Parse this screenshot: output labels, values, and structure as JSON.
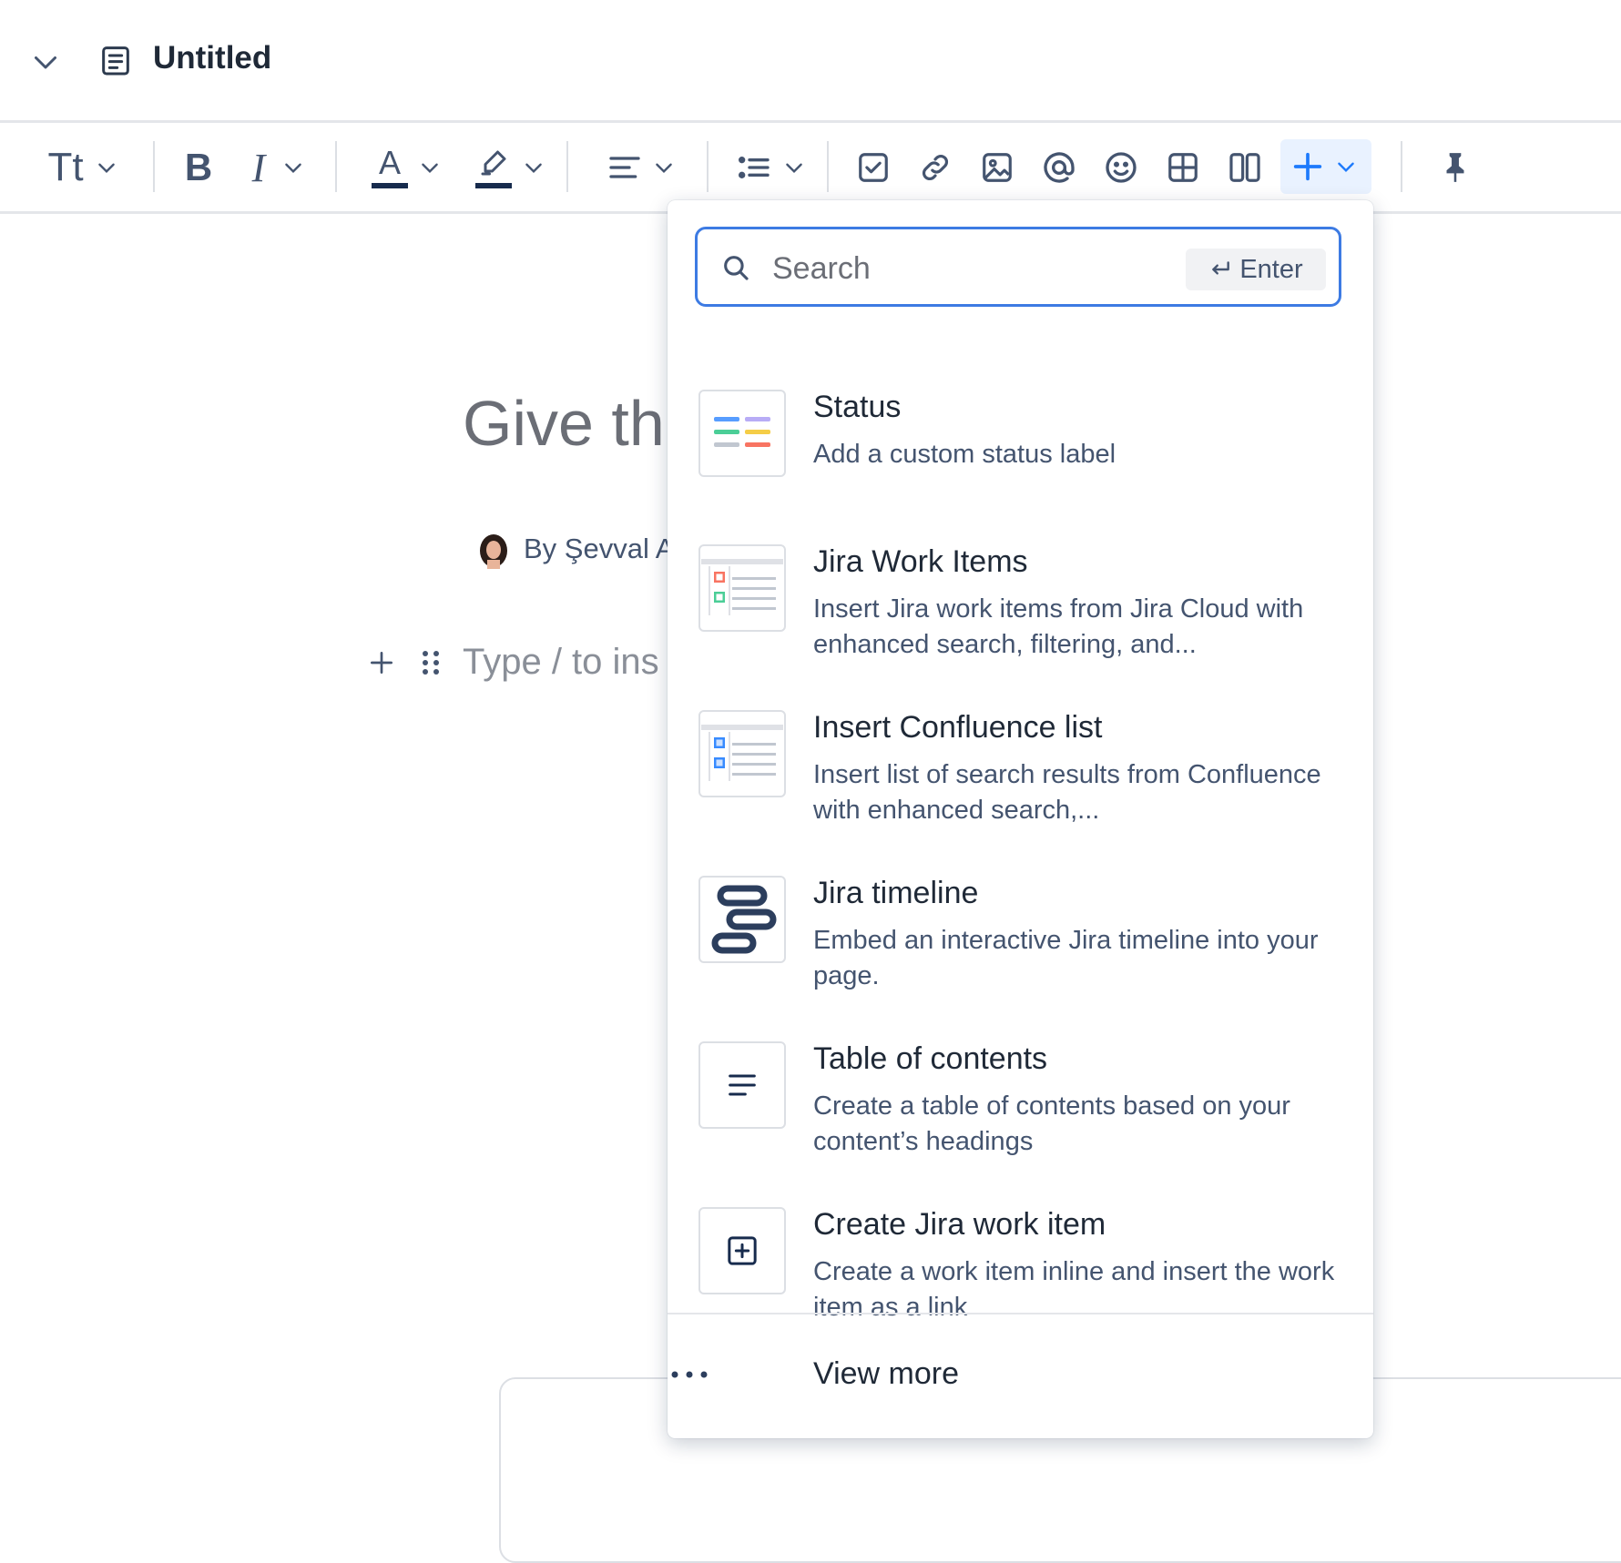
{
  "header": {
    "title": "Untitled",
    "collapse_icon": "chevron-down-icon",
    "page_icon": "document-icon"
  },
  "toolbar": {
    "text_style_label": "Tt",
    "icons": [
      "bold-icon",
      "italic-icon",
      "text-color-icon",
      "highlight-icon",
      "align-icon",
      "list-icon",
      "action-item-icon",
      "link-icon",
      "image-icon",
      "mention-icon",
      "emoji-icon",
      "table-icon",
      "layout-icon",
      "insert-icon",
      "pin-icon"
    ],
    "text_color": "#172b4d",
    "accent": "#1d7afc"
  },
  "editor": {
    "title_placeholder": "Give thi",
    "byline": "By Şevval A",
    "body_placeholder": "Type / to ins"
  },
  "menu": {
    "search": {
      "placeholder": "Search",
      "enter_label": "Enter"
    },
    "items": [
      {
        "title": "Status",
        "description": "Add a custom status label",
        "icon": "status-icon"
      },
      {
        "title": "Jira Work Items",
        "description": "Insert Jira work items from Jira Cloud with enhanced search, filtering, and...",
        "icon": "jira-work-items-icon"
      },
      {
        "title": "Insert Confluence list",
        "description": "Insert list of search results from Confluence with enhanced search,...",
        "icon": "confluence-list-icon"
      },
      {
        "title": "Jira timeline",
        "description": "Embed an interactive Jira timeline into your page.",
        "icon": "timeline-icon"
      },
      {
        "title": "Table of contents",
        "description": "Create a table of contents based on your content’s headings",
        "icon": "table-of-contents-icon"
      },
      {
        "title": "Create Jira work item",
        "description": "Create a work item inline and insert the work item as a link",
        "icon": "add-box-icon"
      }
    ],
    "view_more": "View more"
  }
}
